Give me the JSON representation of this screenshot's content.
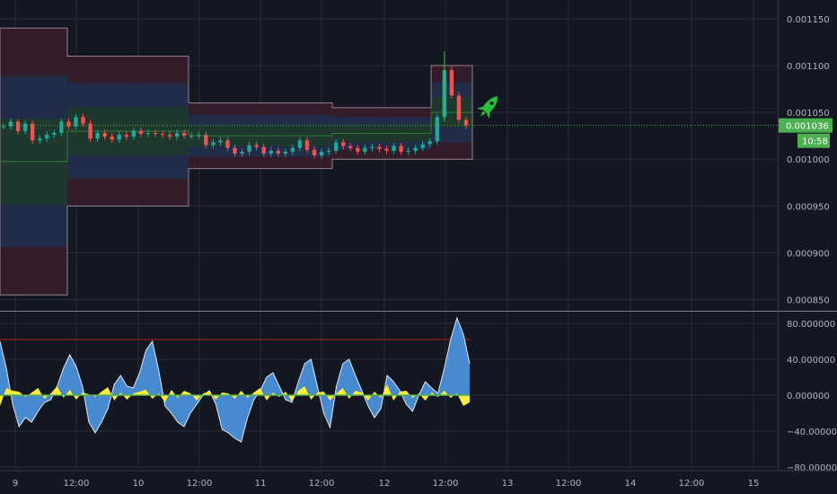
{
  "chart_data": [
    {
      "type": "candlestick",
      "panel": "price",
      "ylim": [
        0.00084,
        0.00117
      ],
      "y_ticks": [
        "0.000850",
        "0.000900",
        "0.000950",
        "0.001000",
        "0.001050",
        "0.001100",
        "0.001150"
      ],
      "y_tick_values": [
        0.00085,
        0.0009,
        0.00095,
        0.001,
        0.00105,
        0.0011,
        0.00115
      ],
      "last_price": {
        "label": "0.001036",
        "value": 0.001036,
        "countdown": "10:58"
      },
      "candles_close": [
        0.001035,
        0.00104,
        0.00103,
        0.001038,
        0.00102,
        0.001022,
        0.001026,
        0.001028,
        0.00104,
        0.001035,
        0.001045,
        0.001038,
        0.001022,
        0.001028,
        0.001024,
        0.001021,
        0.001026,
        0.001024,
        0.00103,
        0.001027,
        0.001028,
        0.001027,
        0.001026,
        0.001024,
        0.001028,
        0.001025,
        0.001025,
        0.001026,
        0.001015,
        0.001018,
        0.00102,
        0.001012,
        0.001006,
        0.001008,
        0.001015,
        0.001013,
        0.001006,
        0.001009,
        0.001006,
        0.001008,
        0.001012,
        0.00102,
        0.00101,
        0.001004,
        0.001008,
        0.001009,
        0.001018,
        0.001014,
        0.001012,
        0.001008,
        0.001012,
        0.001013,
        0.001011,
        0.001009,
        0.001014,
        0.001008,
        0.001009,
        0.001012,
        0.001016,
        0.001019,
        0.001045,
        0.001095,
        0.001068,
        0.001042,
        0.001036
      ],
      "x_ticks": [
        "9",
        "12:00",
        "10",
        "12:00",
        "11",
        "12:00",
        "12",
        "12:00",
        "13",
        "12:00",
        "14",
        "12:00",
        "15"
      ],
      "marker": "rocket-icon"
    },
    {
      "type": "area",
      "panel": "oscillator",
      "ylim": [
        -82,
        92
      ],
      "y_ticks": [
        "80.000000",
        "40.000000",
        "0.000000",
        "−40.000000",
        "−80.000000"
      ],
      "y_tick_values": [
        80,
        40,
        0,
        -40,
        -80
      ],
      "reference_line": 62,
      "series_blue": [
        60,
        30,
        -10,
        -35,
        -25,
        -30,
        -18,
        -8,
        -5,
        10,
        30,
        45,
        32,
        10,
        -30,
        -42,
        -30,
        -15,
        12,
        22,
        10,
        8,
        25,
        50,
        60,
        28,
        -12,
        -20,
        -30,
        -35,
        -20,
        -10,
        0,
        5,
        -10,
        -38,
        -42,
        -48,
        -52,
        -25,
        -5,
        5,
        20,
        25,
        10,
        -5,
        -8,
        15,
        35,
        40,
        10,
        -20,
        -36,
        10,
        35,
        40,
        22,
        5,
        -12,
        -25,
        -15,
        22,
        15,
        5,
        -10,
        -18,
        0,
        15,
        8,
        2,
        30,
        62,
        86,
        68,
        35
      ],
      "series_yellow": [
        -12,
        8,
        5,
        4,
        -2,
        3,
        8,
        -4,
        2,
        10,
        -3,
        6,
        -5,
        3,
        1,
        -2,
        4,
        9,
        -6,
        3,
        -5,
        2,
        4,
        6,
        -4,
        2,
        -8,
        6,
        -3,
        5,
        2,
        -6,
        2,
        4,
        -5,
        3,
        2,
        -4,
        5,
        -3,
        3,
        8,
        -6,
        3,
        -2,
        4,
        -7,
        5,
        10,
        -5,
        3,
        4,
        -6,
        2,
        8,
        -4,
        5,
        3,
        -6,
        4,
        -3,
        12,
        -6,
        4,
        5,
        -3,
        2,
        -6,
        3,
        -2,
        5,
        -3,
        2,
        -12,
        -8
      ],
      "x_ticks": [
        "9",
        "12:00",
        "10",
        "12:00",
        "11",
        "12:00",
        "12",
        "12:00",
        "13",
        "12:00",
        "14",
        "12:00",
        "15"
      ]
    }
  ],
  "colors": {
    "background": "#131722",
    "grid": "#2a2e39",
    "up": "#26a69a",
    "down": "#ef5350",
    "green": "#4caf50",
    "oscillator_fill": "#4a90d9",
    "oscillator_yellow": "#ffeb3b",
    "reference_line": "#b71c1c",
    "price_tag": "#4caf50",
    "rocket": "#26c23a"
  }
}
